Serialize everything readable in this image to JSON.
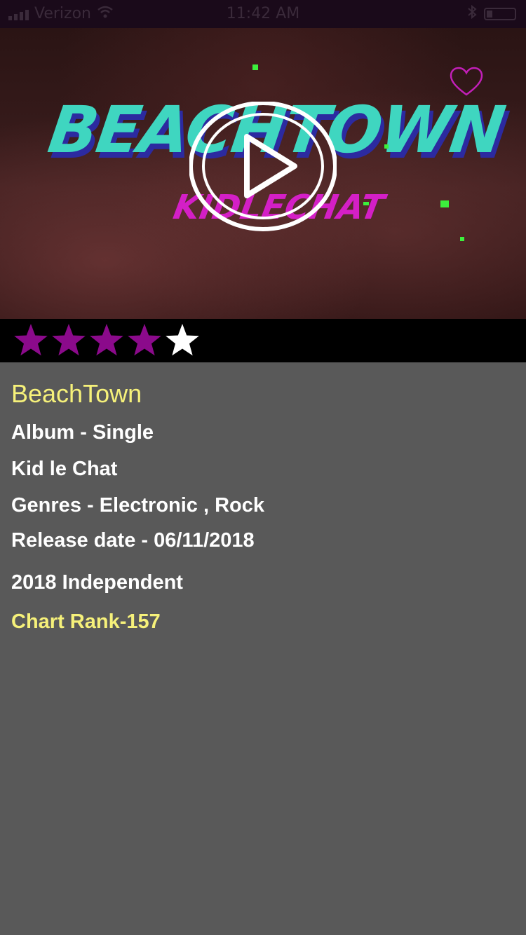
{
  "status_bar": {
    "carrier": "Verizon",
    "time": "11:42 AM"
  },
  "hero": {
    "title_art": "BEACHTOWN",
    "artist_art": "KIDLECHAT",
    "play_icon": "play-circle-icon",
    "favorite_icon": "heart-outline-icon"
  },
  "rating": {
    "value": 4,
    "max": 5,
    "filled_color": "#8B0A8B",
    "empty_color": "#FFFFFF"
  },
  "details": {
    "title": "BeachTown",
    "album": "Album - Single",
    "artist": "Kid le Chat",
    "genres": "Genres - Electronic , Rock",
    "release_date": "Release date - 06/11/2018",
    "copyright": "2018 Independent",
    "chart_rank": "Chart Rank-157"
  },
  "colors": {
    "accent_yellow": "#F6F17A",
    "background": "#595959",
    "heart": "#C21FB8"
  }
}
